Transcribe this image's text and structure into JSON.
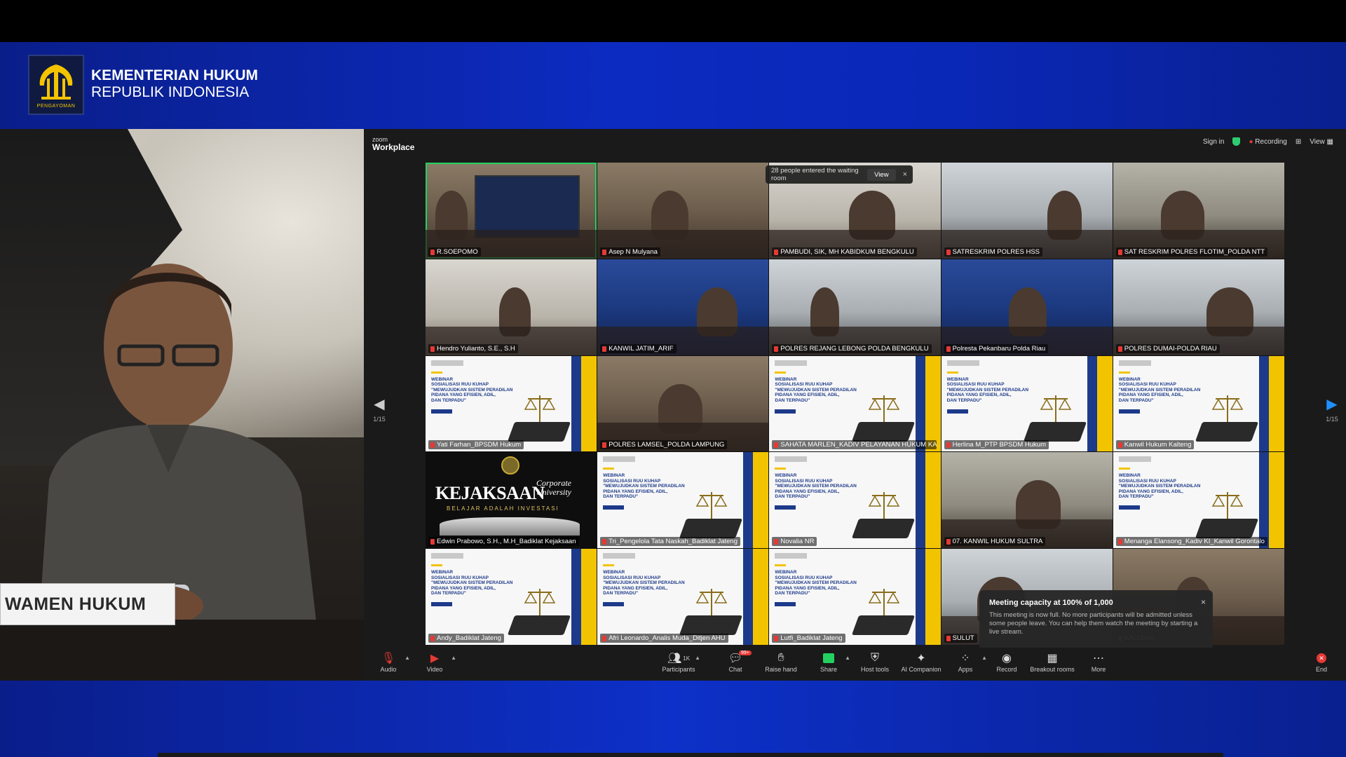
{
  "broadcast": {
    "org_line1": "KEMENTERIAN HUKUM",
    "org_line2": "REPUBLIK INDONESIA",
    "logo_caption": "PENGAYOMAN",
    "nameplate": "WAMEN HUKUM",
    "accent": "#0c2bc0"
  },
  "zoom": {
    "brand_small": "zoom",
    "brand_main": "Workplace",
    "sign_in": "Sign in",
    "recording": "Recording",
    "view": "View",
    "page_left": "1/15",
    "page_right": "1/15",
    "waiting": {
      "text": "28 people entered the waiting room",
      "view_label": "View",
      "close": "×"
    },
    "capacity": {
      "title": "Meeting capacity at 100% of 1,000",
      "body": "This meeting is now full. No more participants will be admitted unless some people leave. You can help them watch the meeting by starting a live stream.",
      "close": "×"
    },
    "slide_text": "WEBINAR\nSOSIALISASI RUU KUHAP\n\"MEWUJUDKAN SISTEM PERADILAN\nPIDANA YANG EFISIEN, ADIL,\nDAN TERPADU\"",
    "kejaksaan": {
      "title": "KEJAKSAAN",
      "corp1": "Corporate",
      "corp2": "University",
      "tagline": "BELAJAR ADALAH INVESTASI"
    },
    "participants": [
      {
        "name": "R.SOEPOMO",
        "kind": "screen"
      },
      {
        "name": "Asep N Mulyana",
        "kind": "office"
      },
      {
        "name": "PAMBUDI, SIK, MH KABIDKUM BENGKULU",
        "kind": "wall"
      },
      {
        "name": "SATRESKRIM POLRES HSS",
        "kind": "room"
      },
      {
        "name": "SAT RESKRIM POLRES FLOTIM_POLDA NTT",
        "kind": "hall"
      },
      {
        "name": "Hendro Yulianto, S.E., S.H",
        "kind": "wall"
      },
      {
        "name": "KANWIL JATIM_ARIF",
        "kind": "blue"
      },
      {
        "name": "POLRES REJANG LEBONG POLDA BENGKULU",
        "kind": "room"
      },
      {
        "name": "Polresta Pekanbaru Polda Riau",
        "kind": "blue"
      },
      {
        "name": "POLRES DUMAI-POLDA RIAU",
        "kind": "room"
      },
      {
        "name": "Yati Farhan_BPSDM Hukum",
        "kind": "slide"
      },
      {
        "name": "POLRES LAMSEL_POLDA LAMPUNG",
        "kind": "office"
      },
      {
        "name": "SAHATA MARLEN_KADIV PELAYANAN HUKUM KAN...",
        "kind": "slide"
      },
      {
        "name": "Herlina M_PTP BPSDM Hukum",
        "kind": "slide"
      },
      {
        "name": "Kanwil Hukum Kalteng",
        "kind": "slide"
      },
      {
        "name": "Edwin Prabowo, S.H., M.H_Badiklat Kejaksaan",
        "kind": "kejaksaan"
      },
      {
        "name": "Tri_Pengelola Tata Naskah_Badiklat Jateng",
        "kind": "slide"
      },
      {
        "name": "Novalia NR",
        "kind": "slide"
      },
      {
        "name": "07. KANWIL HUKUM SULTRA",
        "kind": "hall"
      },
      {
        "name": "Menanga Elansong_Kadiv KI_Kanwil Gorontalo",
        "kind": "slide"
      },
      {
        "name": "Andy_Badiklat Jateng",
        "kind": "slide"
      },
      {
        "name": "Afri Leonardo_Analis Muda_Ditjen AHU",
        "kind": "slide"
      },
      {
        "name": "Lutfi_Badiklat Jateng",
        "kind": "slide"
      },
      {
        "name": "SULUT",
        "kind": "room"
      },
      {
        "name": "KALTENG",
        "kind": "office"
      }
    ],
    "toolbar": {
      "audio": "Audio",
      "video": "Video",
      "participants": "Participants",
      "participants_count": "1K",
      "chat": "Chat",
      "chat_badge": "99+",
      "raise_hand": "Raise hand",
      "share": "Share",
      "host_tools": "Host tools",
      "ai_companion": "AI Companion",
      "apps": "Apps",
      "record": "Record",
      "breakout": "Breakout rooms",
      "more": "More",
      "end": "End"
    }
  }
}
